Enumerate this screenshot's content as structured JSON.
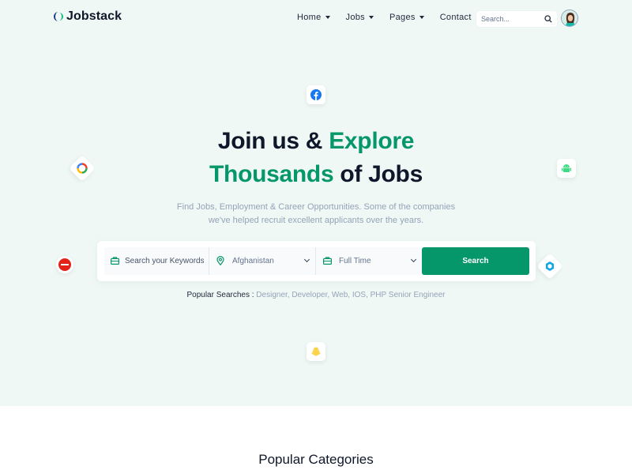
{
  "brand": {
    "name": "Jobstack",
    "accent": "#059669"
  },
  "nav": {
    "items": [
      {
        "label": "Home",
        "has_dropdown": true
      },
      {
        "label": "Jobs",
        "has_dropdown": true
      },
      {
        "label": "Pages",
        "has_dropdown": true
      },
      {
        "label": "Contact",
        "has_dropdown": false
      }
    ],
    "search_placeholder": "Search...",
    "search_icon": "search-icon",
    "avatar": "user-avatar"
  },
  "hero": {
    "title_part1": "Join us & ",
    "title_highlight1": "Explore",
    "title_highlight2": "Thousands",
    "title_part2": " of Jobs",
    "subtitle_line1": "Find Jobs, Employment & Career Opportunities. Some of the companies",
    "subtitle_line2": "we've helped recruit excellent applicants over the years.",
    "floating_icons": [
      "facebook-icon",
      "google-circle-icon",
      "android-icon",
      "lenovo-icon",
      "dropbox-icon",
      "snapchat-icon"
    ]
  },
  "search": {
    "keyword_placeholder": "Search your Keywords",
    "location_value": "Afghanistan",
    "type_value": "Full Time",
    "button_label": "Search"
  },
  "popular": {
    "label": "Popular Searches :",
    "terms": " Designer, Developer, Web, IOS, PHP Senior Engineer"
  },
  "categories": {
    "title": "Popular Categories"
  }
}
